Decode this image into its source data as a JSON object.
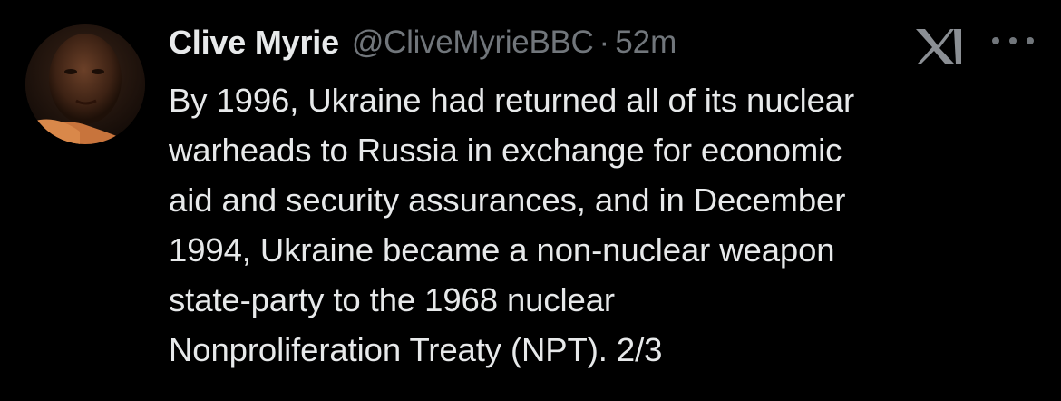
{
  "tweet": {
    "author_name": "Clive Myrie",
    "handle": "@CliveMyrieBBC",
    "separator": "·",
    "timestamp": "52m",
    "text_lines": [
      "By 1996, Ukraine had returned all of its nuclear",
      "warheads to Russia in exchange for economic",
      "aid and security assurances, and in December",
      "1994, Ukraine became a non-nuclear weapon",
      "state-party to the 1968 nuclear",
      "Nonproliferation Treaty (NPT). 2/3"
    ]
  },
  "icons": {
    "x_logo": "x-logo-icon",
    "more": "more-options-icon"
  },
  "colors": {
    "background": "#000000",
    "primary_text": "#e7e9ea",
    "secondary_text": "#71767b"
  }
}
